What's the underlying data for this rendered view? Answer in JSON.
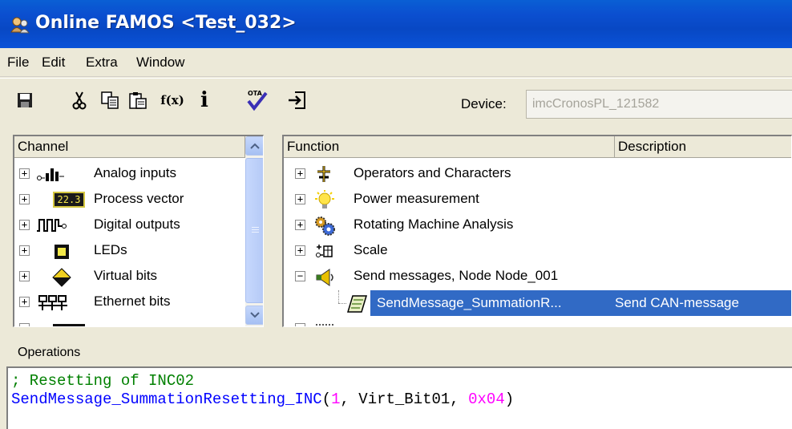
{
  "window": {
    "title": "Online FAMOS <Test_032>"
  },
  "menu": [
    "File",
    "Edit",
    "Extra",
    "Window"
  ],
  "toolbar": {
    "icons": [
      "save-icon",
      "cut-icon",
      "copy-icon",
      "paste-icon",
      "function-icon",
      "info-icon",
      "ota-check-icon",
      "import-icon"
    ],
    "fx_label": "f(x)",
    "ota_label": "OTA",
    "device_label": "Device:",
    "device_value": "imcCronosPL_121582"
  },
  "channel_panel": {
    "header": "Channel",
    "items": [
      {
        "label": "Analog inputs",
        "icon": "analog-inputs-icon"
      },
      {
        "label": "Process vector",
        "icon": "process-vector-icon",
        "icon_text": "22.3"
      },
      {
        "label": "Digital outputs",
        "icon": "digital-outputs-icon"
      },
      {
        "label": "LEDs",
        "icon": "led-icon"
      },
      {
        "label": "Virtual bits",
        "icon": "virtual-bits-icon"
      },
      {
        "label": "Ethernet bits",
        "icon": "ethernet-bits-icon"
      }
    ]
  },
  "function_panel": {
    "headers": {
      "function": "Function",
      "description": "Description"
    },
    "items": [
      {
        "label": "Operators and Characters",
        "expanded": false,
        "icon": "operators-icon"
      },
      {
        "label": "Power measurement",
        "expanded": false,
        "icon": "lightbulb-icon"
      },
      {
        "label": "Rotating Machine Analysis",
        "expanded": false,
        "icon": "gears-icon"
      },
      {
        "label": "Scale",
        "expanded": false,
        "icon": "scale-icon"
      },
      {
        "label": "Send messages, Node Node_001",
        "expanded": true,
        "icon": "megaphone-icon"
      }
    ],
    "selected_child": {
      "label": "SendMessage_SummationR...",
      "description": "Send CAN-message",
      "icon": "message-icon"
    }
  },
  "operations": {
    "label": "Operations",
    "comment_line": "; Resetting of INC02",
    "code": {
      "func": "SendMessage_SummationResetting_INC",
      "open": "(",
      "arg1": "1",
      "sep1": ", Virt_Bit01, ",
      "arg3": "0x04",
      "close": ")"
    }
  },
  "colors": {
    "titlebar": "#0b4fd0",
    "selection": "#316ac5",
    "comment": "#008000",
    "keyword": "#0000ff",
    "number": "#ff00ff"
  }
}
